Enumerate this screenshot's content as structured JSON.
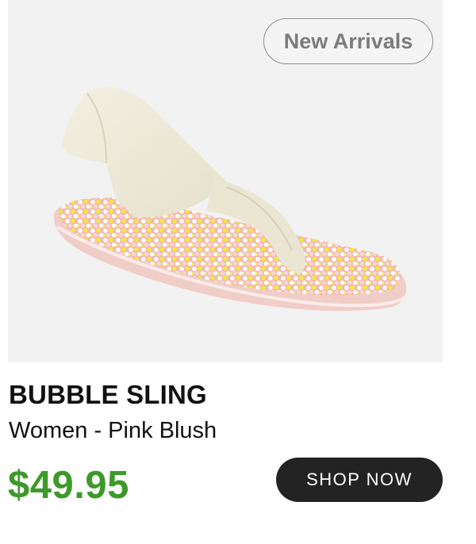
{
  "badge": {
    "label": "New Arrivals"
  },
  "product": {
    "name": "BUBBLE SLING",
    "subtitle": "Women - Pink Blush",
    "price": "$49.95",
    "cta_label": "SHOP NOW",
    "image_icon": "sandal-image"
  },
  "colors": {
    "hero_background": "#f2f2f2",
    "price": "#3d9a2a",
    "button": "#232323",
    "sole": "#f1cdc8",
    "strap": "#efebdb"
  }
}
